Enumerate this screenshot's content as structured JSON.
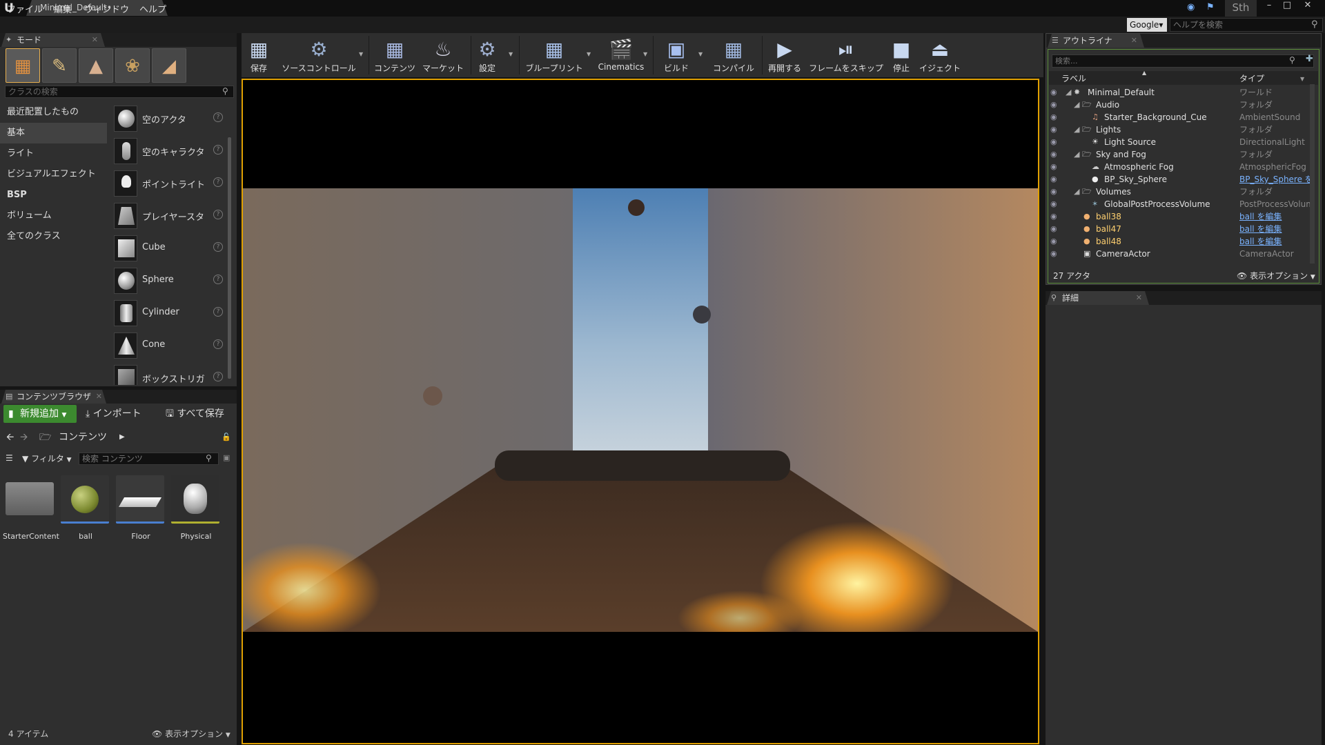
{
  "window": {
    "doc_tab": "Minimal_Default•",
    "user": "Sth",
    "minimize": "–",
    "restore": "□",
    "close": "✕"
  },
  "menu": {
    "items": [
      "ファイル",
      "編集",
      "ウィンドウ",
      "ヘルプ"
    ],
    "search_engine": "Google▾",
    "help_placeholder": "ヘルプを検索"
  },
  "modes": {
    "tab": "モード",
    "search_placeholder": "クラスの検索",
    "categories": [
      "最近配置したもの",
      "基本",
      "ライト",
      "ビジュアルエフェクト",
      "BSP",
      "ボリューム",
      "全てのクラス"
    ],
    "selected_category": "基本",
    "items": [
      "空のアクタ",
      "空のキャラクタ",
      "ポイントライト",
      "プレイヤースタ",
      "Cube",
      "Sphere",
      "Cylinder",
      "Cone",
      "ボックストリガ"
    ]
  },
  "content_browser": {
    "tab": "コンテンツブラウザ",
    "new_button": "新規追加",
    "import_button": "インポート",
    "saveall_button": "すべて保存",
    "path": "コンテンツ",
    "filter": "フィルタ",
    "search_placeholder": "検索 コンテンツ",
    "assets": [
      "StarterContent",
      "ball",
      "Floor",
      "Physical"
    ],
    "count": "4 アイテム",
    "view_options": "表示オプション"
  },
  "toolbar": {
    "buttons": [
      "保存",
      "ソースコントロール",
      "コンテンツ",
      "マーケット",
      "設定",
      "ブループリント",
      "Cinematics",
      "ビルド",
      "コンパイル",
      "再開する",
      "フレームをスキップ",
      "停止",
      "イジェクト"
    ]
  },
  "outliner": {
    "tab": "アウトライナ",
    "search_placeholder": "検索...",
    "col_label": "ラベル",
    "col_type": "タイプ",
    "rows": [
      {
        "name": "Minimal_Default",
        "type": "ワールド"
      },
      {
        "name": "Audio",
        "type": "フォルダ"
      },
      {
        "name": "Starter_Background_Cue",
        "type": "AmbientSound"
      },
      {
        "name": "Lights",
        "type": "フォルダ"
      },
      {
        "name": "Light Source",
        "type": "DirectionalLight"
      },
      {
        "name": "Sky and Fog",
        "type": "フォルダ"
      },
      {
        "name": "Atmospheric Fog",
        "type": "AtmosphericFog"
      },
      {
        "name": "BP_Sky_Sphere",
        "type": "BP_Sky_Sphere を"
      },
      {
        "name": "Volumes",
        "type": "フォルダ"
      },
      {
        "name": "GlobalPostProcessVolume",
        "type": "PostProcessVolum"
      },
      {
        "name": "ball38",
        "type": "ball を編集"
      },
      {
        "name": "ball47",
        "type": "ball を編集"
      },
      {
        "name": "ball48",
        "type": "ball を編集"
      },
      {
        "name": "CameraActor",
        "type": "CameraActor"
      }
    ],
    "count": "27 アクタ",
    "view_options": "表示オプション"
  },
  "details": {
    "tab": "詳細"
  },
  "colors": {
    "accent_green": "#3c8a2f",
    "viewport_border": "#e0a000",
    "link": "#7ab3ff",
    "outliner_border": "#5c8f3c"
  }
}
